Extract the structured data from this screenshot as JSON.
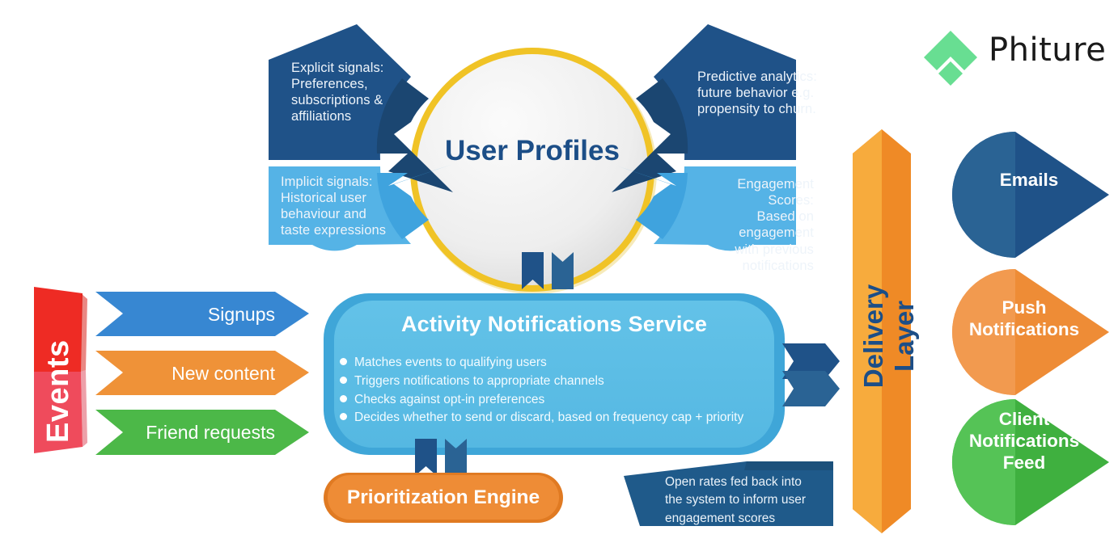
{
  "brand": {
    "name": "Phiture",
    "logo_icon": "phiture-chevron-logo",
    "logo_color": "#68de92"
  },
  "center": {
    "title": "User\nProfiles",
    "ring_color": "#f0c326",
    "fill_color": "#f1f1f1",
    "text_color": "#1c4e87"
  },
  "profile_inputs": [
    {
      "id": "explicit-signals",
      "text": "Explicit signals:\nPreferences,\nsubscriptions &\naffiliations",
      "color": "#1f5288",
      "align": "left"
    },
    {
      "id": "implicit-signals",
      "text": "Implicit signals:\nHistorical user\nbehaviour and\ntaste expressions",
      "color": "#55b3e6",
      "align": "left"
    },
    {
      "id": "predictive-analytics",
      "text": "Predictive analytics:\nfuture behavior e.g.\npropensity to churn.",
      "color": "#1f5288",
      "align": "left"
    },
    {
      "id": "engagement-scores",
      "text": "Engagement Scores:\nBased on engagement\nwith previous\nnotifications",
      "color": "#55b3e6",
      "align": "right"
    }
  ],
  "events": {
    "banner_label": "Events",
    "banner_color_top": "#ee2b24",
    "banner_color_bottom": "#ef4b5c",
    "items": [
      {
        "label": "Signups",
        "color": "#3787d2"
      },
      {
        "label": "New content",
        "color": "#ef9238"
      },
      {
        "label": "Friend requests",
        "color": "#4cb848"
      }
    ]
  },
  "service": {
    "title": "Activity Notifications Service",
    "color": "#5bbce4",
    "border_color": "#3fa6d8",
    "bullets": [
      "Matches events to qualifying users",
      "Triggers notifications to appropriate channels",
      "Checks against opt-in preferences",
      "Decides whether to send or discard, based on frequency cap + priority"
    ]
  },
  "prioritization": {
    "label": "Prioritization Engine",
    "color": "#ee8c36",
    "border_color": "#e07a22"
  },
  "feedback": {
    "text": "Open rates fed back into\nthe system to inform user\nengagement scores",
    "color": "#1f5a8a"
  },
  "delivery": {
    "label": "Delivery\nLayer",
    "label_line1": "Delivery",
    "label_line2": "Layer",
    "color_light": "#f7ab3d",
    "color_dark": "#ef8a26",
    "text_color": "#1c4e87"
  },
  "channels": [
    {
      "label": "Emails",
      "color_light": "#2a6394",
      "color_dark": "#1f5288"
    },
    {
      "label": "Push\nNotifications",
      "color_light": "#f29a4f",
      "color_dark": "#ee8c36"
    },
    {
      "label": "Client\nNotifications\nFeed",
      "color_light": "#55c356",
      "color_dark": "#3fb03f"
    }
  ],
  "connectors": {
    "profiles_to_service": "ribbon-pair-vertical",
    "service_to_prioritization": "ribbon-pair-vertical",
    "service_to_delivery": "ribbon-pair-horizontal"
  }
}
